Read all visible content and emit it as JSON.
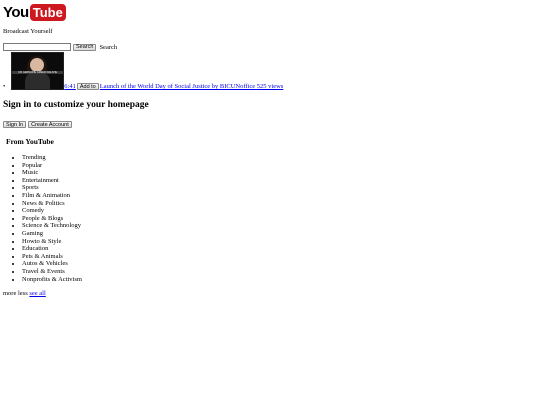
{
  "logo": {
    "you": "You",
    "tube": "Tube"
  },
  "tagline": "Broadcast Yourself",
  "search": {
    "placeholder": "",
    "value": "",
    "button_label": "Search",
    "trailing_label": "Search"
  },
  "featured": {
    "duration": "6:41",
    "add_to_label": "Add to",
    "title": "Launch of the World Day of Social Justice by BICUNoffice",
    "views": "525 views",
    "thumb_caption": "DR GERMAINE GREER-WALSHE"
  },
  "signin": {
    "heading": "Sign in to customize your homepage",
    "signin_label": "Sign In",
    "create_label": "Create Account"
  },
  "from_youtube": {
    "heading": "From YouTube",
    "categories": [
      "Trending",
      "Popular",
      "Music",
      "Entertainment",
      "Sports",
      "Film & Animation",
      "News & Politics",
      "Comedy",
      "People & Blogs",
      "Science & Technology",
      "Gaming",
      "Howto & Style",
      "Education",
      "Pets & Animals",
      "Autos & Vehicles",
      "Travel & Events",
      "Nonprofits & Activism"
    ]
  },
  "footer": {
    "more": "more",
    "less": "less",
    "see_all": "see all"
  },
  "colors": {
    "brand_red": "#cc181e",
    "link_blue": "#0000ee"
  }
}
